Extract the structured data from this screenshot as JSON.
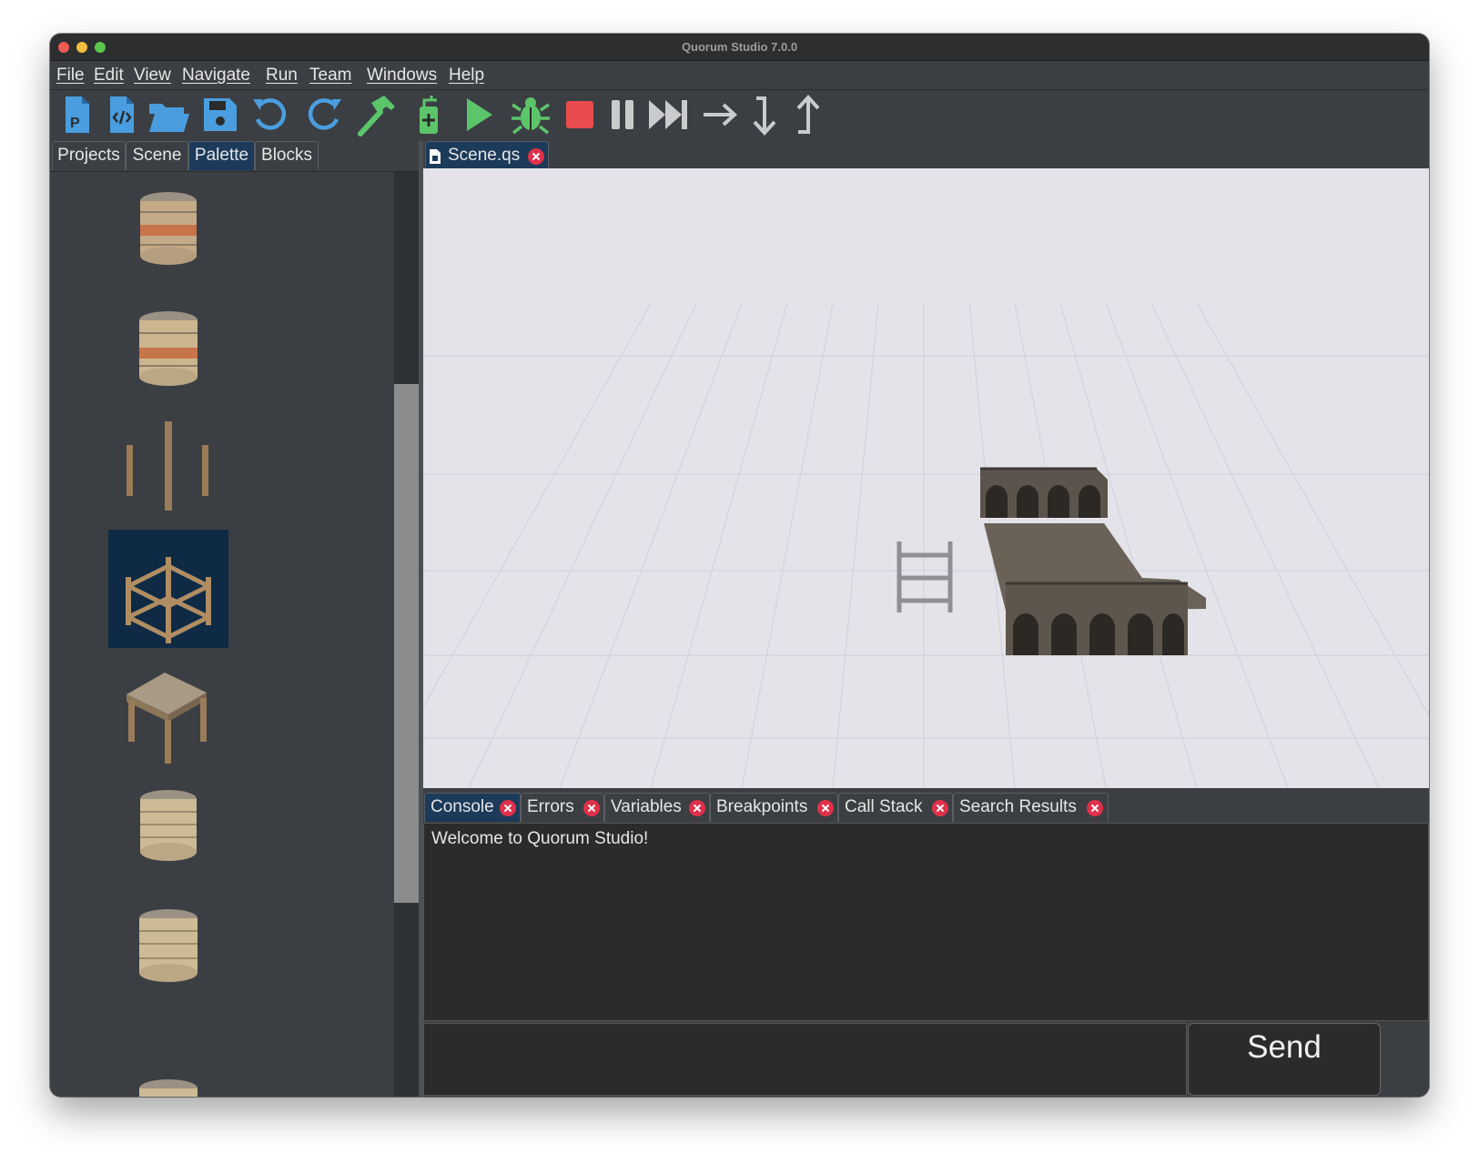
{
  "window": {
    "title": "Quorum Studio 7.0.0"
  },
  "menu": {
    "items": [
      "File",
      "Edit",
      "View",
      "Navigate",
      "Run",
      "Team",
      "Windows",
      "Help"
    ]
  },
  "toolbar": {
    "tools": [
      "new-project-icon",
      "new-file-icon",
      "open-folder-icon",
      "save-icon",
      "undo-icon",
      "redo-icon",
      "build-hammer-icon",
      "clean-build-icon",
      "run-icon",
      "debug-bug-icon",
      "stop-icon",
      "pause-icon",
      "step-over-end-icon",
      "step-over-icon",
      "step-into-icon",
      "step-out-icon"
    ]
  },
  "left_panel": {
    "tabs": [
      "Projects",
      "Scene",
      "Palette",
      "Blocks"
    ],
    "active_tab": "Palette",
    "palette_items": [
      "stone-tower-icon",
      "stone-tower-icon",
      "wooden-posts-icon",
      "wooden-fence-icon",
      "wooden-table-icon",
      "stone-cylinder-icon",
      "stone-cylinder-icon",
      "stone-cylinder-icon"
    ],
    "selected_item_index": 3
  },
  "editor": {
    "tab": "Scene.qs"
  },
  "bottom_panel": {
    "tabs": [
      "Console",
      "Errors",
      "Variables",
      "Breakpoints",
      "Call Stack",
      "Search Results"
    ],
    "active_tab": "Console",
    "console_text": "Welcome to Quorum Studio!",
    "send_label": "Send"
  },
  "colors": {
    "accent_tab": "#1c3a5a",
    "run_green": "#5cc56a",
    "stop_red": "#e84c4c",
    "toolbar_blue": "#4a9ee0",
    "close_red": "#e0304a"
  }
}
